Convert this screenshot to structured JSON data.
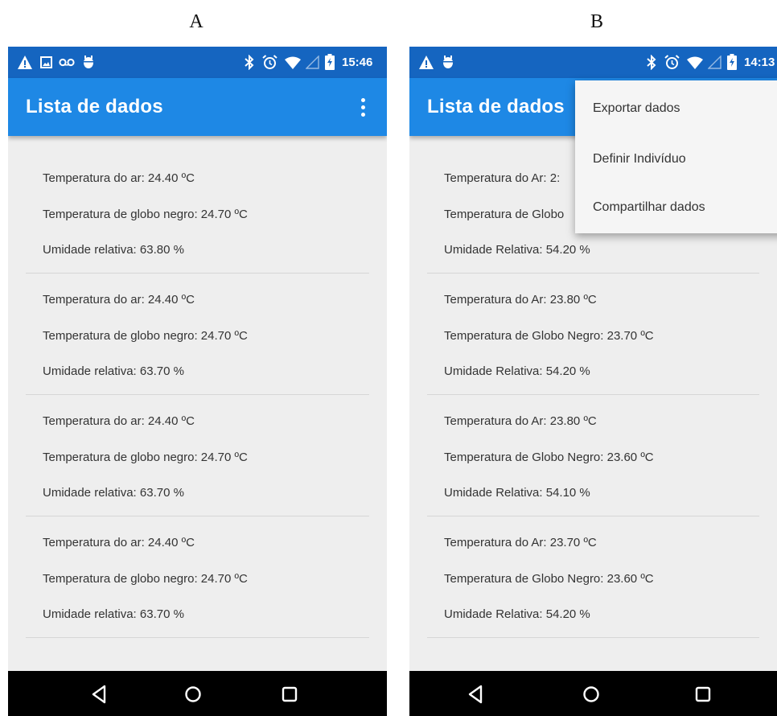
{
  "panels": [
    {
      "letter": "A",
      "status_time": "15:46",
      "app_title": "Lista de dados",
      "records": [
        {
          "l1": "Temperatura do ar: 24.40 ºC",
          "l2": "Temperatura de globo negro: 24.70 ºC",
          "l3": "Umidade relativa: 63.80 %"
        },
        {
          "l1": "Temperatura do ar: 24.40 ºC",
          "l2": "Temperatura de globo negro: 24.70 ºC",
          "l3": "Umidade relativa: 63.70 %"
        },
        {
          "l1": "Temperatura do ar: 24.40 ºC",
          "l2": "Temperatura de globo negro: 24.70 ºC",
          "l3": "Umidade relativa: 63.70 %"
        },
        {
          "l1": "Temperatura do ar: 24.40 ºC",
          "l2": "Temperatura de globo negro: 24.70 ºC",
          "l3": "Umidade relativa: 63.70 %"
        }
      ]
    },
    {
      "letter": "B",
      "status_time": "14:13",
      "app_title": "Lista de dados",
      "records": [
        {
          "l1": "Temperatura do Ar: 2:",
          "l2": "Temperatura de Globo",
          "l3": "Umidade Relativa: 54.20 %"
        },
        {
          "l1": "Temperatura do Ar: 23.80 ºC",
          "l2": "Temperatura de Globo Negro: 23.70 ºC",
          "l3": "Umidade Relativa: 54.20 %"
        },
        {
          "l1": "Temperatura do Ar: 23.80 ºC",
          "l2": "Temperatura de Globo Negro: 23.60 ºC",
          "l3": "Umidade Relativa: 54.10 %"
        },
        {
          "l1": "Temperatura do Ar: 23.70 ºC",
          "l2": "Temperatura de Globo Negro: 23.60 ºC",
          "l3": "Umidade Relativa: 54.20 %"
        }
      ],
      "menu": [
        "Exportar dados",
        "Definir Indivíduo",
        "Compartilhar dados"
      ]
    }
  ],
  "icons": {
    "status_left_a": [
      "warning-icon",
      "image-icon",
      "voicemail-icon",
      "android-debug-icon"
    ],
    "status_left_b": [
      "warning-icon",
      "android-debug-icon"
    ],
    "status_right": [
      "bluetooth-icon",
      "alarm-icon",
      "wifi-icon",
      "signal-icon",
      "battery-charging-icon"
    ],
    "nav": [
      "back-icon",
      "home-icon",
      "recents-icon"
    ],
    "overflow": "more-vert-icon"
  },
  "colors": {
    "status_bar": "#1565c0",
    "app_bar": "#1e88e5",
    "background": "#eeeeee",
    "nav_bar": "#000000"
  }
}
